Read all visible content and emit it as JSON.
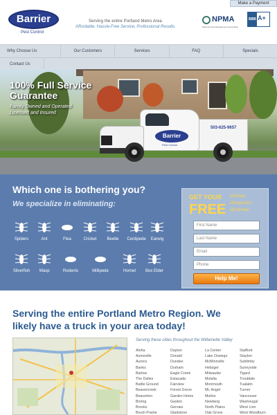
{
  "header": {
    "logo_text": "Barrier",
    "logo_sub": "Pest Control",
    "tagline_1": "Serving the entire Portland Metro Area",
    "tagline_2": "Affordable, Hassle-Free Service, Professional Results.",
    "npma": "NPMA",
    "npma_sub": "National Pest Management Association",
    "bbb_left": "BBB",
    "bbb_grade": "A+",
    "make_payment": "Make a Payment"
  },
  "nav": {
    "row1": [
      "Why Choose Us",
      "Our Customers",
      "Services",
      "FAQ",
      "Specials"
    ],
    "row2": [
      "Contact Us"
    ]
  },
  "hero": {
    "title_line1": "100% Full Service",
    "title_line2": "Guarantee",
    "sub_line1": "Family Owned and Operated",
    "sub_line2": "Licensed and Insured",
    "truck_logo": "Barrier",
    "truck_logo_sub": "Pest Control",
    "truck_phone": "503-625-9657"
  },
  "bugs": {
    "title": "Which one is bothering you?",
    "subtitle": "We specialize in eliminating:",
    "items": [
      "Spiders",
      "Ant",
      "Flea",
      "Cricket",
      "Beetle",
      "Centipede",
      "Earwig",
      "Silverfish",
      "Wasp",
      "Rodents",
      "Millipede",
      "Hornet",
      "Box Elder"
    ]
  },
  "form": {
    "get_your": "GET YOUR",
    "free": "FREE",
    "checks": [
      "Advice",
      "Inspection",
      "Estimate"
    ],
    "placeholders": {
      "first": "First Name",
      "last": "Last Name",
      "email": "Email",
      "phone": "Phone"
    },
    "submit": "Help Me!"
  },
  "serving": {
    "title": "Serving the entire Portland Metro Region. We likely have a truck in your area today!",
    "cities_head": "Serving these cities throughout the Willamette Valley",
    "cities": [
      [
        "Aloha",
        "Aumsville",
        "Aurora",
        "Banks",
        "Barlow",
        "The Dalles",
        "Battle Ground",
        "Beavercreek",
        "Beaverton",
        "Boring",
        "Brooks",
        "Brush Prairie"
      ],
      [
        "Dayton",
        "Donald",
        "Dundee",
        "Durham",
        "Eagle Creek",
        "Estacada",
        "Fairview",
        "Forest Grove",
        "Garden Home",
        "Gaston",
        "Gervais",
        "Gladstone"
      ],
      [
        "La Center",
        "Lake Oswego",
        "McMinnville",
        "Hebzger",
        "Milwaukie",
        "Molalla",
        "Monmouth",
        "Mt. Angel",
        "Mulino",
        "Newberg",
        "North Plains",
        "Oak Grove"
      ],
      [
        "Stafford",
        "Stayton",
        "Sublimity",
        "Sunnyside",
        "Tigard",
        "Troutdale",
        "Tualatin",
        "Turner",
        "Vancouver",
        "Washougal",
        "West Linn",
        "West Woodburn"
      ]
    ]
  },
  "colors": {
    "brand_blue": "#2a3f8f",
    "section_blue": "#5b7cad",
    "accent_yellow": "#ffd54a",
    "button_orange": "#e87a12"
  }
}
